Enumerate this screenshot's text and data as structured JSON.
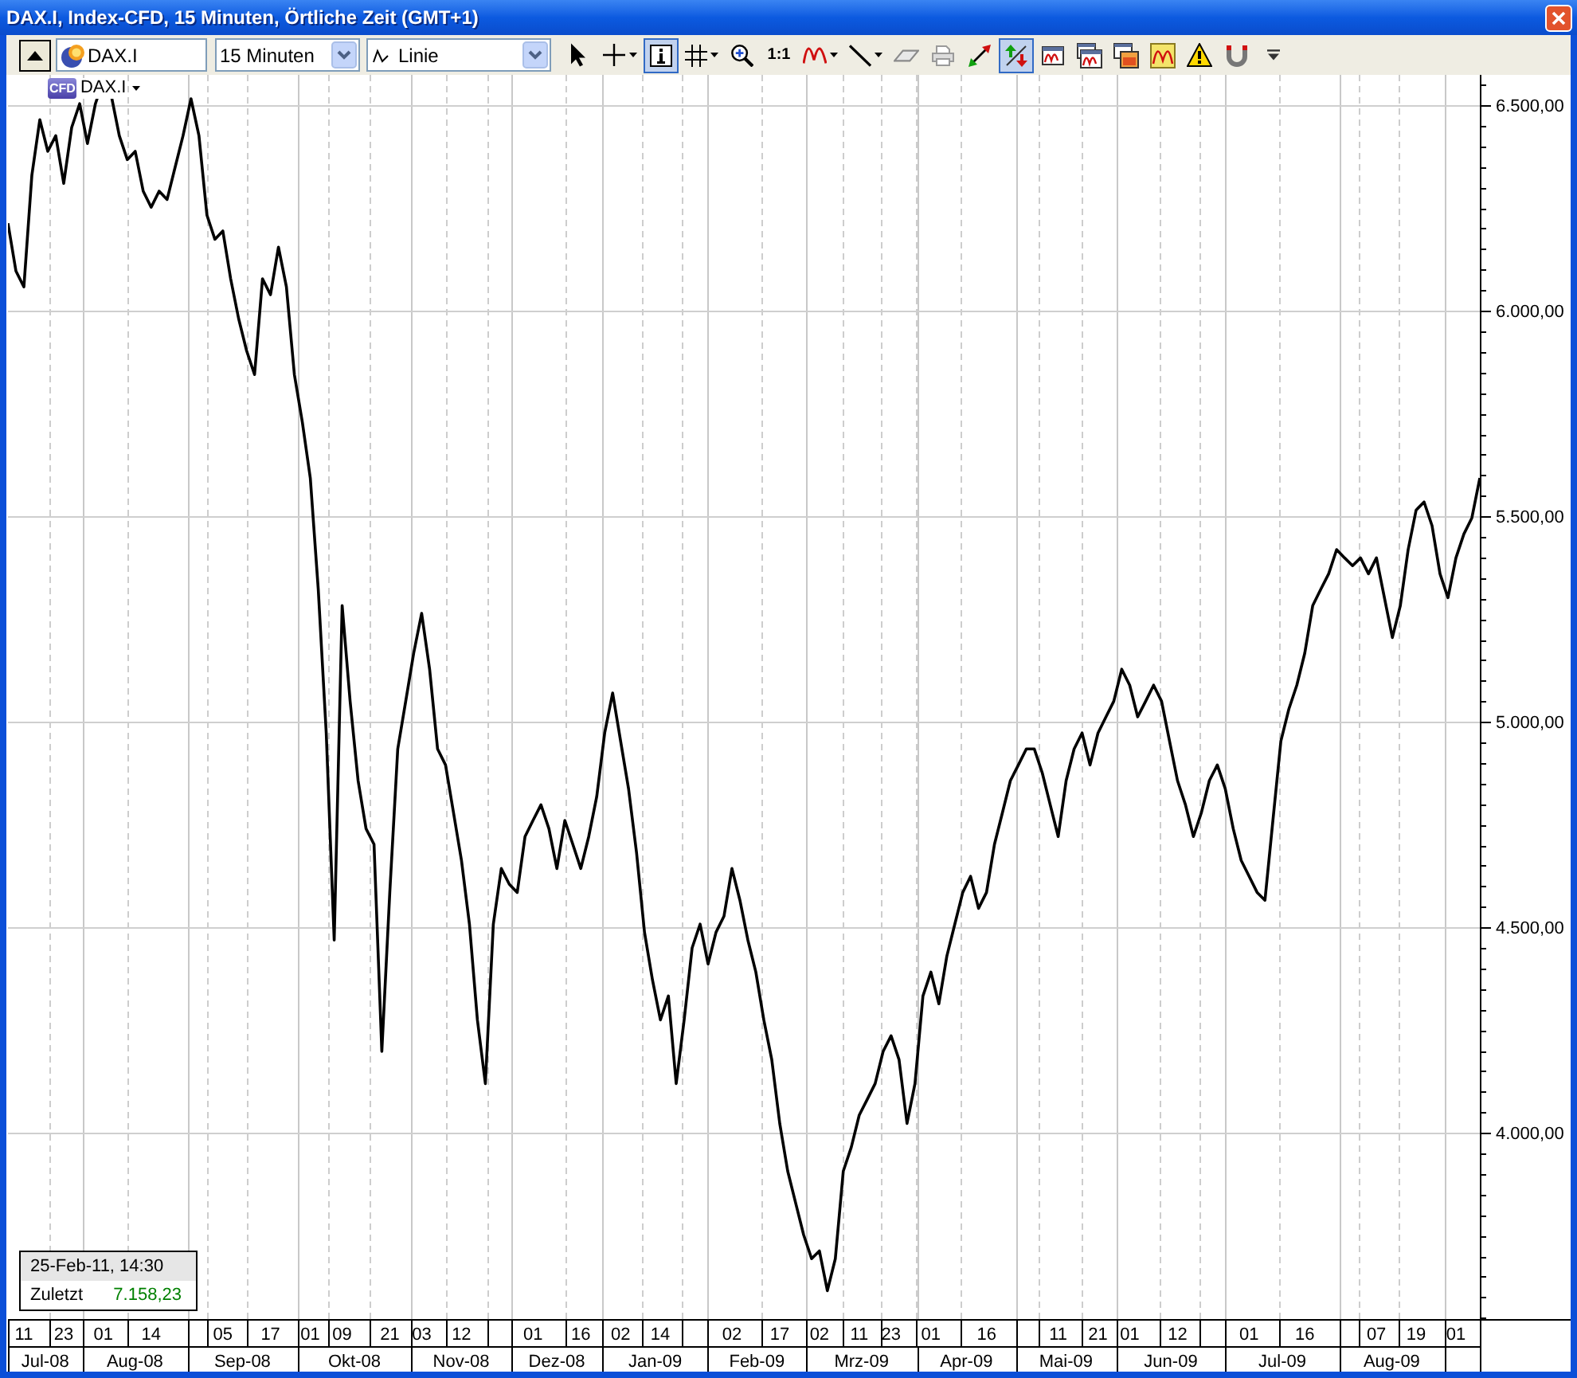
{
  "window": {
    "title": "DAX.I, Index-CFD, 15 Minuten, Örtliche Zeit (GMT+1)"
  },
  "toolbar": {
    "symbol": {
      "value": "DAX.I"
    },
    "interval": {
      "value": "15 Minuten"
    },
    "chart_type": {
      "value": "Linie"
    },
    "tools": [
      {
        "kind": "pointer",
        "selected": false,
        "menu": false
      },
      {
        "kind": "crosshair",
        "selected": false,
        "menu": true
      },
      {
        "kind": "info",
        "selected": true,
        "menu": false
      },
      {
        "kind": "grid",
        "selected": false,
        "menu": true
      },
      {
        "kind": "zoom",
        "selected": false,
        "menu": false
      },
      {
        "kind": "ratio",
        "label": "1:1",
        "selected": false,
        "menu": false
      },
      {
        "kind": "indicator",
        "selected": false,
        "menu": true
      },
      {
        "kind": "line",
        "selected": false,
        "menu": true
      },
      {
        "kind": "eraser",
        "selected": false,
        "menu": false
      },
      {
        "kind": "printer",
        "selected": false,
        "menu": false
      },
      {
        "kind": "measure",
        "selected": false,
        "menu": false
      },
      {
        "kind": "signals",
        "selected": true,
        "menu": false
      },
      {
        "kind": "window",
        "selected": false,
        "menu": false
      },
      {
        "kind": "windows",
        "selected": false,
        "menu": false
      },
      {
        "kind": "picture",
        "selected": false,
        "menu": false
      },
      {
        "kind": "wave_tile",
        "selected": false,
        "menu": false
      },
      {
        "kind": "warning",
        "selected": false,
        "menu": false
      },
      {
        "kind": "magnet",
        "selected": false,
        "menu": false
      },
      {
        "kind": "more",
        "selected": false,
        "menu": false
      }
    ]
  },
  "chart": {
    "legend": {
      "badge": "CFD"
    },
    "chart_data": {
      "type": "line",
      "grid": true,
      "ylim": [
        3547,
        6574
      ],
      "categories": [
        null,
        null,
        "11",
        null,
        null,
        null,
        null,
        "23",
        null,
        null,
        null,
        null,
        "01",
        null,
        null,
        null,
        null,
        null,
        "14",
        null,
        null,
        null,
        null,
        null,
        null,
        null,
        null,
        "05",
        null,
        null,
        null,
        null,
        null,
        "17",
        null,
        null,
        null,
        null,
        "01",
        null,
        null,
        null,
        "09",
        null,
        null,
        null,
        null,
        null,
        "21",
        null,
        null,
        null,
        "03",
        null,
        null,
        null,
        null,
        "12",
        null,
        null,
        null,
        null,
        null,
        null,
        null,
        null,
        "01",
        null,
        null,
        null,
        null,
        null,
        "16",
        null,
        null,
        null,
        null,
        "02",
        null,
        null,
        null,
        null,
        "14",
        null,
        null,
        null,
        null,
        null,
        null,
        null,
        null,
        "02",
        null,
        null,
        null,
        null,
        null,
        "17",
        null,
        null,
        null,
        null,
        "02",
        null,
        null,
        null,
        null,
        "11",
        null,
        null,
        null,
        "23",
        null,
        null,
        null,
        null,
        "01",
        null,
        null,
        null,
        null,
        null,
        null,
        "16",
        null,
        null,
        null,
        null,
        null,
        null,
        null,
        null,
        "11",
        null,
        null,
        null,
        null,
        "21",
        null,
        null,
        null,
        "01",
        null,
        null,
        null,
        null,
        null,
        "12",
        null,
        null,
        null,
        null,
        null,
        null,
        null,
        null,
        "01",
        null,
        null,
        null,
        null,
        null,
        null,
        "16",
        null,
        null,
        null,
        null,
        null,
        null,
        null,
        null,
        "07",
        null,
        null,
        null,
        null,
        "19",
        null,
        null,
        null,
        null,
        "01",
        null,
        null,
        null
      ],
      "yticks": [
        {
          "value": 4000,
          "label": "4.000,00"
        },
        {
          "value": 4500,
          "label": "4.500,00"
        },
        {
          "value": 5000,
          "label": "5.000,00"
        },
        {
          "value": 5500,
          "label": "5.500,00"
        },
        {
          "value": 6000,
          "label": "6.000,00"
        },
        {
          "value": 6500,
          "label": "6.500,00"
        }
      ],
      "series": [
        {
          "name": "DAX.I",
          "color": "#000000",
          "values": [
            6213,
            6097,
            6058,
            6330,
            6465,
            6388,
            6426,
            6310,
            6446,
            6504,
            6407,
            6504,
            6562,
            6523,
            6426,
            6368,
            6388,
            6291,
            6252,
            6291,
            6271,
            6349,
            6426,
            6516,
            6426,
            6233,
            6174,
            6194,
            6078,
            5981,
            5903,
            5845,
            6078,
            6039,
            6155,
            6058,
            5845,
            5729,
            5593,
            5322,
            4973,
            4469,
            5283,
            5050,
            4857,
            4740,
            4702,
            4198,
            4585,
            4934,
            5050,
            5167,
            5264,
            5128,
            4934,
            4895,
            4779,
            4663,
            4508,
            4275,
            4120,
            4508,
            4643,
            4605,
            4585,
            4721,
            4760,
            4798,
            4740,
            4643,
            4760,
            4702,
            4643,
            4721,
            4818,
            4973,
            5070,
            4953,
            4837,
            4682,
            4488,
            4372,
            4275,
            4333,
            4120,
            4275,
            4450,
            4508,
            4411,
            4488,
            4527,
            4643,
            4566,
            4469,
            4391,
            4275,
            4178,
            4023,
            3907,
            3829,
            3752,
            3694,
            3713,
            3616,
            3694,
            3907,
            3965,
            4043,
            4081,
            4120,
            4198,
            4236,
            4178,
            4023,
            4120,
            4333,
            4391,
            4314,
            4430,
            4508,
            4585,
            4624,
            4546,
            4585,
            4702,
            4779,
            4857,
            4895,
            4934,
            4934,
            4876,
            4798,
            4721,
            4857,
            4934,
            4973,
            4895,
            4973,
            5012,
            5050,
            5128,
            5089,
            5012,
            5050,
            5089,
            5050,
            4953,
            4857,
            4798,
            4721,
            4779,
            4857,
            4895,
            4837,
            4740,
            4663,
            4624,
            4585,
            4566,
            4760,
            4953,
            5031,
            5089,
            5167,
            5283,
            5322,
            5360,
            5419,
            5399,
            5380,
            5399,
            5360,
            5399,
            5302,
            5205,
            5283,
            5419,
            5515,
            5535,
            5477,
            5360,
            5302,
            5399,
            5457,
            5496,
            5593
          ]
        }
      ]
    },
    "info_box": {
      "timestamp": "25-Feb-11, 14:30",
      "label": "Zuletzt",
      "value": "7.158,23"
    }
  },
  "time_axis": {
    "months": [
      "Jul-08",
      "Aug-08",
      "Sep-08",
      "Okt-08",
      "Nov-08",
      "Dez-08",
      "Jan-09",
      "Feb-09",
      "Mrz-09",
      "Apr-09",
      "Mai-09",
      "Jun-09",
      "Jul-09",
      "Aug-09"
    ]
  }
}
